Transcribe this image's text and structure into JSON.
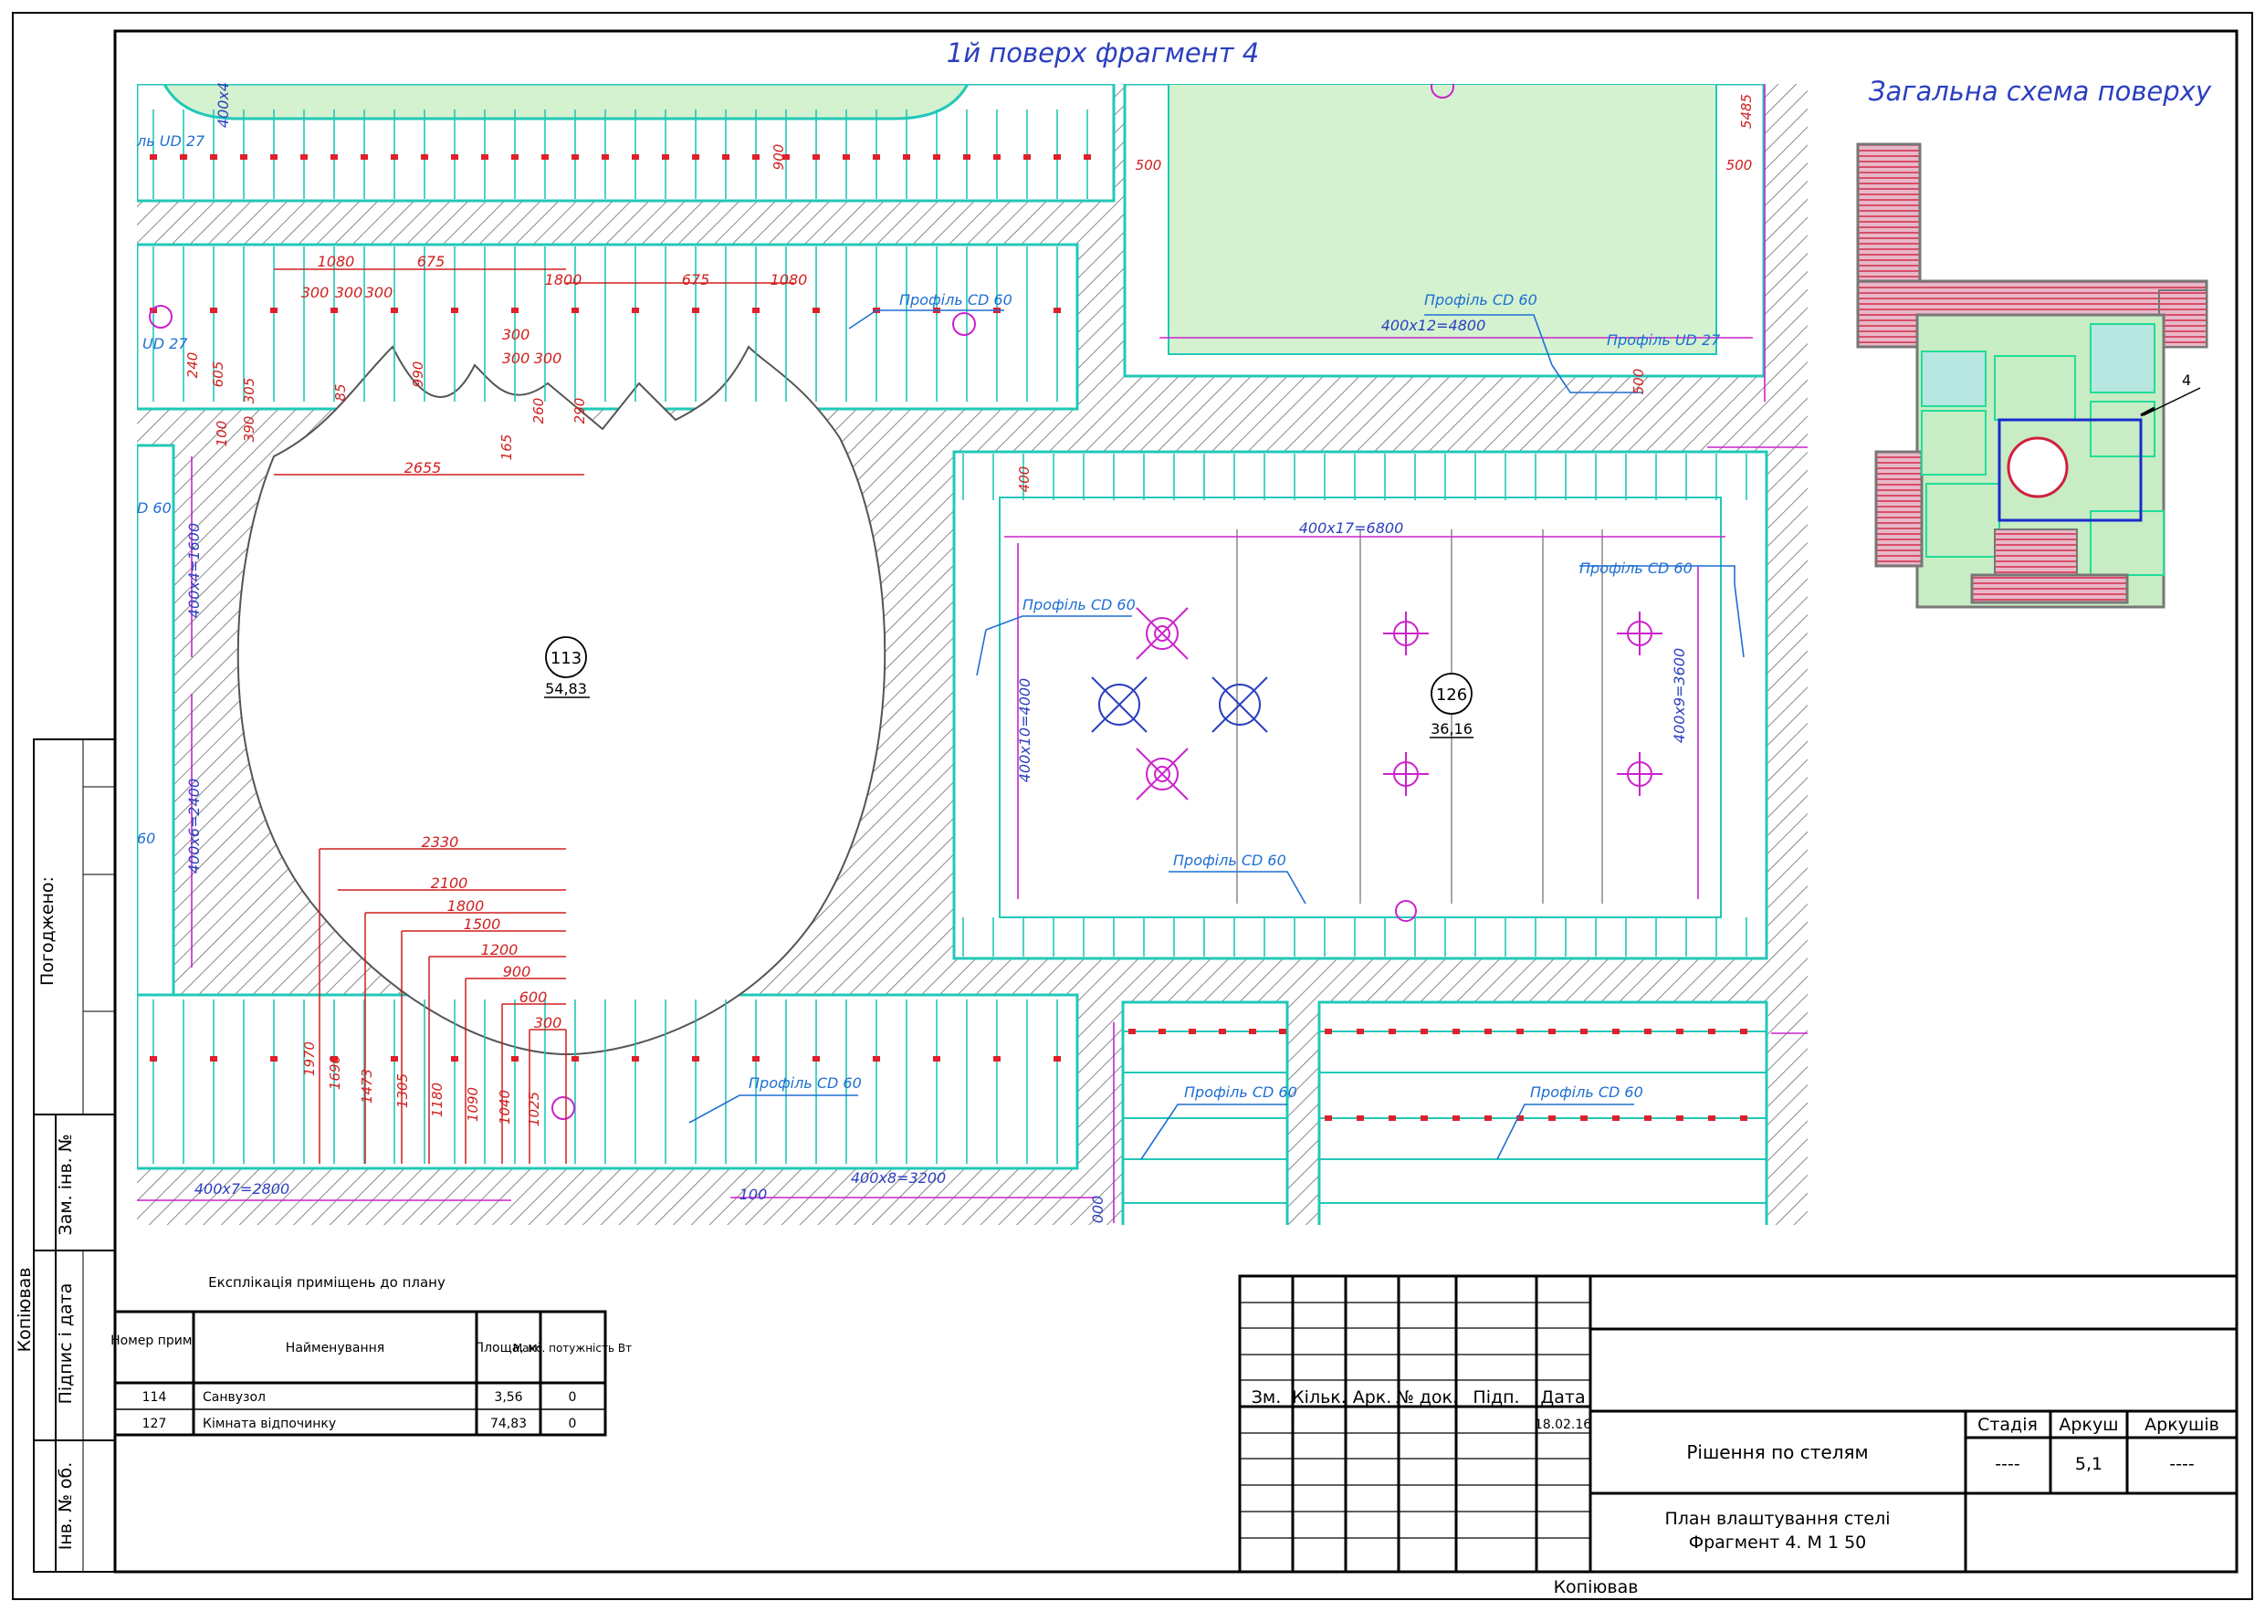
{
  "sheet": {
    "title": "1й поверх фрагмент 4",
    "overview_title": "Загальна схема поверху",
    "overview_marker": "4",
    "approval_label": "Погоджено:",
    "author_vertical": "Копіював",
    "author_bottom": "Копіював"
  },
  "side_stamp": {
    "zam_inv": "Зам. інв. №",
    "pidpys": "Підпис і дата",
    "inv_orig": "Інв. № об."
  },
  "rooms": [
    {
      "number": "113",
      "area": "54,83"
    },
    {
      "number": "126",
      "area": "36,16"
    }
  ],
  "profile_labels": {
    "cd60": "Профіль CD 60",
    "ud27": "Профіль UD 27",
    "ud27_short": "ль UD 27",
    "ud27_frag": "UD 27",
    "cd60_frag": "D 60",
    "cd60_frag2": "60"
  },
  "dimensions": {
    "top_left": [
      "1080",
      "675",
      "1800",
      "675",
      "1080",
      "300",
      "300",
      "300",
      "300",
      "300",
      "300",
      "2655",
      "85",
      "165",
      "260",
      "290",
      "990",
      "605",
      "305",
      "390",
      "100",
      "240"
    ],
    "arc_bottom": [
      "2330",
      "2100",
      "1800",
      "1500",
      "1200",
      "900",
      "600",
      "300"
    ],
    "arc_bottom_vertical": [
      "1970",
      "1690",
      "1473",
      "1305",
      "1180",
      "1090",
      "1040",
      "1025"
    ],
    "grid": [
      "400x12=4800",
      "400x17=6800",
      "400x10=4000",
      "400x9=3600",
      "400x4=1600",
      "400x6=2400",
      "400x7=2800",
      "400x8=3200",
      "500",
      "500",
      "500",
      "5485",
      "900",
      "400",
      "100",
      "400x4",
      "000"
    ]
  },
  "explication": {
    "title": "Експлікація приміщень до плану",
    "headers": [
      "Номер прим.",
      "Найменування",
      "Площа, м²",
      "Макс. потужність Вт"
    ],
    "rows": [
      [
        "114",
        "Санвузол",
        "3,56",
        "0"
      ],
      [
        "127",
        "Кімната відпочинку",
        "74,83",
        "0"
      ]
    ]
  },
  "title_block": {
    "col_headers": [
      "Зм.",
      "Кільк.",
      "Арк.",
      "№ док.",
      "Підп.",
      "Дата"
    ],
    "date": "18.02.16",
    "stage_headers": [
      "Стадія",
      "Аркуш",
      "Аркушів"
    ],
    "stage_values": [
      "----",
      "5,1",
      "----"
    ],
    "work_name": "Рішення по стелям",
    "drawing_name_1": "План влаштування стелі",
    "drawing_name_2": "Фрагмент 4. М 1 50"
  },
  "colors": {
    "frame": "#000000",
    "title_blue": "#2b3fbf",
    "profile_blue": "#1f6fd1",
    "dim_red": "#d01f1f",
    "magenta": "#cc22cc",
    "cyan": "#21c8b8",
    "green_fill": "#d4f2d0",
    "hatch": "#555555"
  }
}
